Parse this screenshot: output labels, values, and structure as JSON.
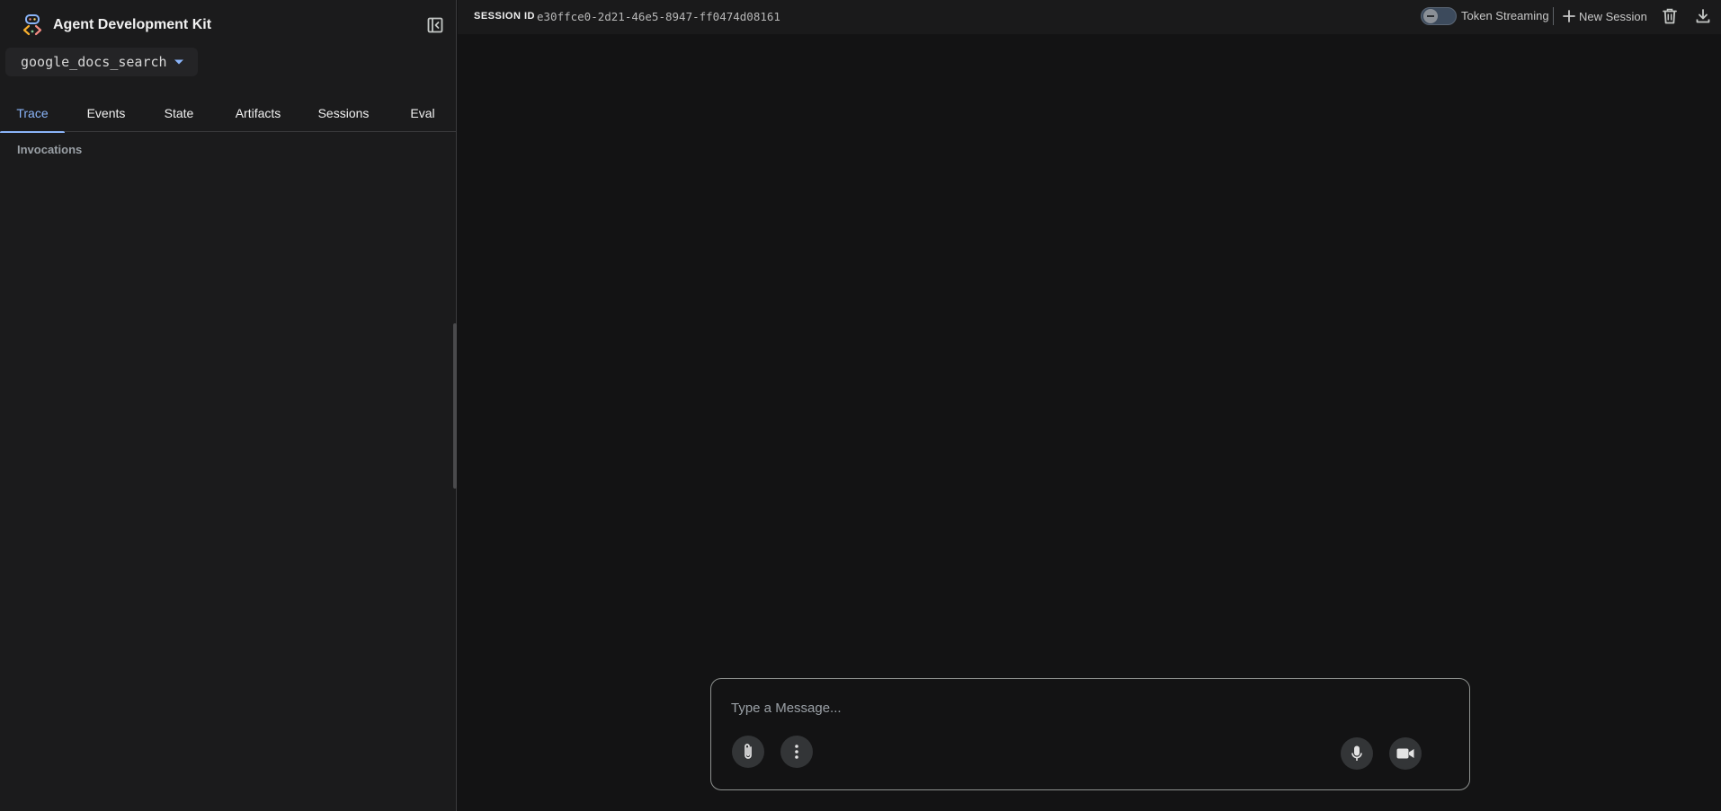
{
  "app": {
    "title": "Agent Development Kit",
    "logo_icon": "adk-logo-icon"
  },
  "sidebar": {
    "agent_select": {
      "value": "google_docs_search",
      "caret_icon": "caret-down-icon"
    },
    "collapse_icon": "collapse-sidebar-icon",
    "tabs": [
      {
        "label": "Trace",
        "active": true
      },
      {
        "label": "Events",
        "active": false
      },
      {
        "label": "State",
        "active": false
      },
      {
        "label": "Artifacts",
        "active": false
      },
      {
        "label": "Sessions",
        "active": false
      },
      {
        "label": "Eval",
        "active": false
      }
    ],
    "section_title": "Invocations"
  },
  "topbar": {
    "session_label": "SESSION ID",
    "session_id": "e30ffce0-2d21-46e5-8947-ff0474d08161",
    "token_streaming": {
      "label": "Token Streaming",
      "enabled": false
    },
    "new_session_label": "New Session",
    "icons": [
      "plus-icon",
      "trash-icon",
      "download-icon"
    ]
  },
  "composer": {
    "placeholder": "Type a Message...",
    "icons": [
      "attach-icon",
      "more-vert-icon",
      "mic-icon",
      "videocam-icon"
    ]
  },
  "colors": {
    "background": "#131314",
    "sidebar_bg": "#1b1b1c",
    "accent": "#8ab4f8",
    "border": "#3a3a3c"
  }
}
